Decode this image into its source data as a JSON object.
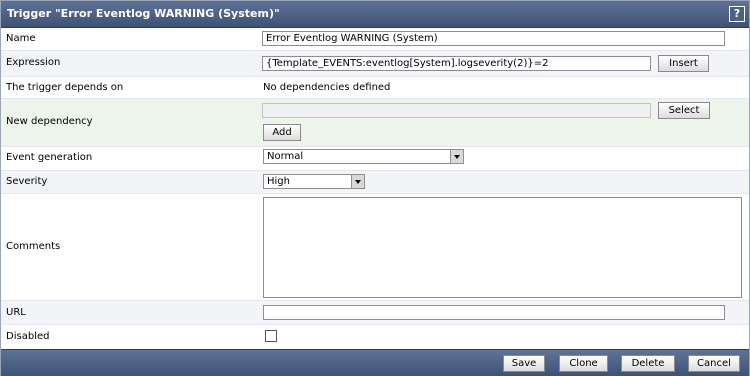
{
  "dialog": {
    "title": "Trigger \"Error Eventlog WARNING (System)\"",
    "help_label": "?"
  },
  "form": {
    "name": {
      "label": "Name",
      "value": "Error Eventlog WARNING (System)"
    },
    "expression": {
      "label": "Expression",
      "value": "{Template_EVENTS:eventlog[System].logseverity(2)}=2",
      "insert_label": "Insert"
    },
    "depends": {
      "label": "The trigger depends on",
      "value": "No dependencies defined"
    },
    "new_dependency": {
      "label": "New dependency",
      "value": "",
      "select_label": "Select",
      "add_label": "Add"
    },
    "event_generation": {
      "label": "Event generation",
      "selected": "Normal"
    },
    "severity": {
      "label": "Severity",
      "selected": "High"
    },
    "comments": {
      "label": "Comments",
      "value": ""
    },
    "url": {
      "label": "URL",
      "value": ""
    },
    "disabled": {
      "label": "Disabled",
      "checked": false
    }
  },
  "footer": {
    "save_label": "Save",
    "clone_label": "Clone",
    "delete_label": "Delete",
    "cancel_label": "Cancel"
  },
  "colors": {
    "titlebar": "#4f6388",
    "row_alt": "#f2f4f8",
    "row_highlight": "#edf5ea"
  }
}
